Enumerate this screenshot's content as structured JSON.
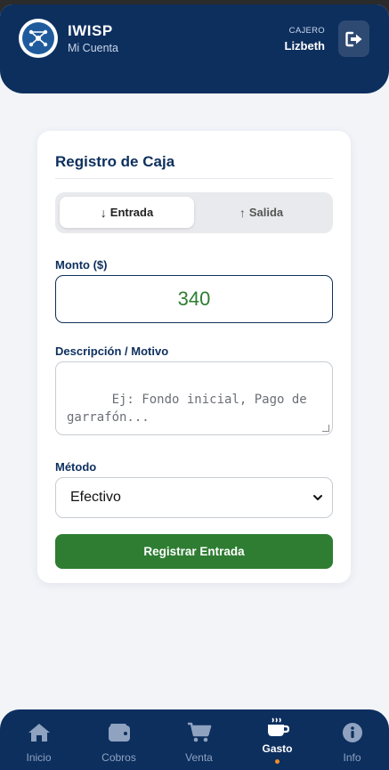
{
  "header": {
    "brand": "IWISP",
    "subtitle": "Mi Cuenta",
    "cashier_label": "CAJERO",
    "cashier_name": "Lizbeth",
    "logout_icon": "logout-icon",
    "logo_icon": "network-icon"
  },
  "form": {
    "title": "Registro de Caja",
    "toggle": {
      "entrada": "Entrada",
      "salida": "Salida",
      "selected": "Entrada"
    },
    "monto_label": "Monto ($)",
    "monto_value": "340",
    "descripcion_label": "Descripción / Motivo",
    "descripcion_placeholder": "Ej: Fondo inicial, Pago de garrafón...",
    "metodo_label": "Método",
    "metodo_value": "Efectivo",
    "submit_label": "Registrar Entrada"
  },
  "nav": {
    "items": [
      {
        "label": "Inicio",
        "icon": "home-icon"
      },
      {
        "label": "Cobros",
        "icon": "wallet-icon"
      },
      {
        "label": "Venta",
        "icon": "cart-icon"
      },
      {
        "label": "Gasto",
        "icon": "coffee-icon"
      },
      {
        "label": "Info",
        "icon": "info-icon"
      }
    ],
    "active": "Gasto"
  },
  "colors": {
    "primary": "#0d2f5e",
    "success": "#2e7d32",
    "accent": "#f28c28",
    "background": "#f2f4f8"
  }
}
